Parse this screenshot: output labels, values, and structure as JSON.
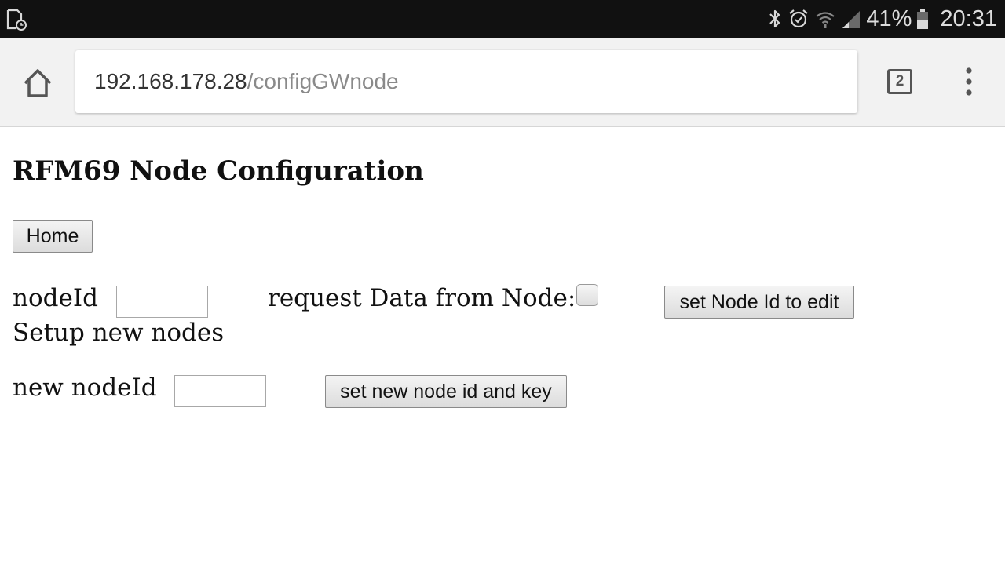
{
  "status_bar": {
    "battery_percent": "41%",
    "time": "20:31",
    "icons": [
      "sim-card-icon",
      "bluetooth-icon",
      "alarm-icon",
      "wifi-icon",
      "signal-icon",
      "battery-icon"
    ]
  },
  "browser": {
    "url_host": "192.168.178.28",
    "url_path": "/configGWnode",
    "tab_count": "2",
    "icons": [
      "home-icon",
      "tabs-icon",
      "more-vert-icon"
    ]
  },
  "page": {
    "title": "RFM69 Node Configuration",
    "home_button": "Home",
    "node_id_label": "nodeId",
    "node_id_value": "",
    "request_data_label": "request Data from Node:",
    "request_data_checked": false,
    "set_node_id_button": "set Node Id to edit",
    "setup_new_nodes_label": "Setup new nodes",
    "new_node_id_label": "new nodeId",
    "new_node_id_value": "",
    "set_new_node_button": "set new node id and key"
  },
  "colors": {
    "status_bar_bg": "#111111",
    "toolbar_bg": "#f2f2f2",
    "url_host_color": "#333333",
    "url_path_color": "#8a8a8a"
  }
}
